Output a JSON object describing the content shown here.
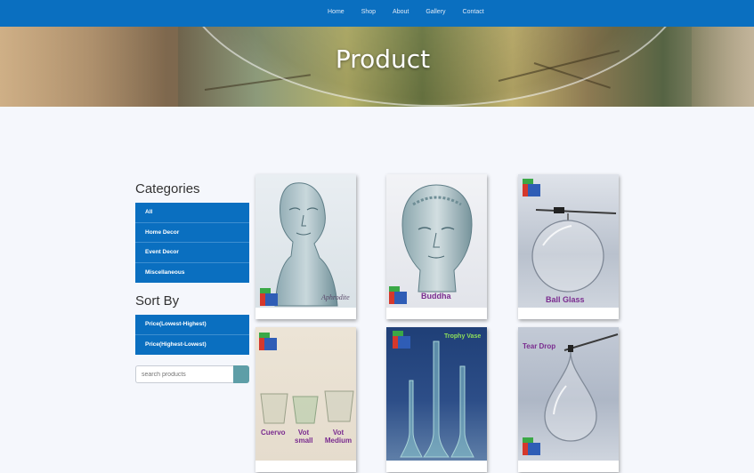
{
  "nav": {
    "links": [
      "Home",
      "Shop",
      "About",
      "Gallery",
      "Contact"
    ]
  },
  "hero": {
    "title": "Product"
  },
  "sidebar": {
    "categories_title": "Categories",
    "categories": [
      "All",
      "Home Decor",
      "Event Decor",
      "Miscellaneous"
    ],
    "sort_title": "Sort By",
    "sort_options": [
      "Price(Lowest-Highest)",
      "Price(Highest-Lowest)"
    ],
    "search_placeholder": "search products"
  },
  "products": [
    {
      "name": "Aphrodite",
      "caption": "Aphrodite"
    },
    {
      "name": "Buddha",
      "caption": "Buddha"
    },
    {
      "name": "Ball Glass",
      "caption": "Ball Glass"
    },
    {
      "name": "Cuervo / Vot small / Vot Medium",
      "captions": [
        "Cuervo",
        "Vot small",
        "Vot Medium"
      ]
    },
    {
      "name": "Trophy Vase",
      "caption": "Trophy Vase"
    },
    {
      "name": "Tear Drop",
      "caption": "Tear Drop"
    }
  ],
  "colors": {
    "nav": "#0a6fc0",
    "menu": "#0a6fc0",
    "search_button": "#5e9ea7",
    "caption": "#7a2c8f"
  }
}
